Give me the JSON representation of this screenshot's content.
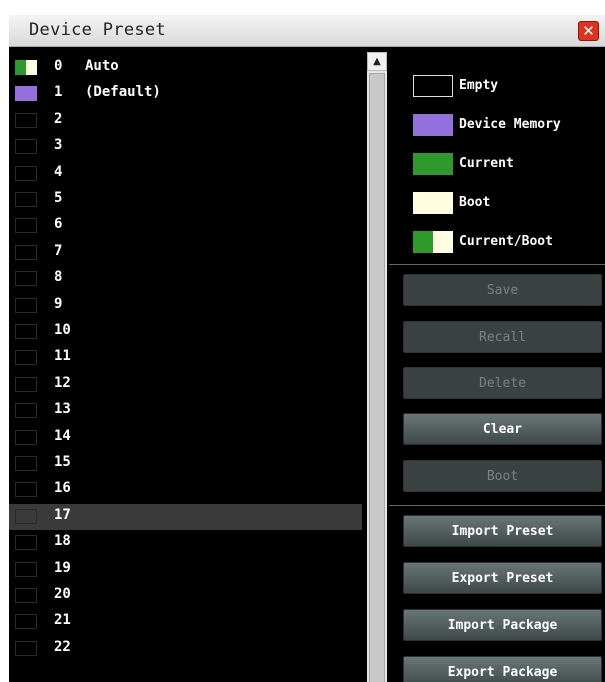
{
  "window": {
    "title": "Device Preset",
    "close_symbol": "✕"
  },
  "presets": [
    {
      "num": "0",
      "name": "Auto",
      "state": "current_boot"
    },
    {
      "num": "1",
      "name": "(Default)",
      "state": "device_memory"
    },
    {
      "num": "2",
      "name": "",
      "state": "empty"
    },
    {
      "num": "3",
      "name": "",
      "state": "empty"
    },
    {
      "num": "4",
      "name": "",
      "state": "empty"
    },
    {
      "num": "5",
      "name": "",
      "state": "empty"
    },
    {
      "num": "6",
      "name": "",
      "state": "empty"
    },
    {
      "num": "7",
      "name": "",
      "state": "empty"
    },
    {
      "num": "8",
      "name": "",
      "state": "empty"
    },
    {
      "num": "9",
      "name": "",
      "state": "empty"
    },
    {
      "num": "10",
      "name": "",
      "state": "empty"
    },
    {
      "num": "11",
      "name": "",
      "state": "empty"
    },
    {
      "num": "12",
      "name": "",
      "state": "empty"
    },
    {
      "num": "13",
      "name": "",
      "state": "empty"
    },
    {
      "num": "14",
      "name": "",
      "state": "empty"
    },
    {
      "num": "15",
      "name": "",
      "state": "empty"
    },
    {
      "num": "16",
      "name": "",
      "state": "empty"
    },
    {
      "num": "17",
      "name": "",
      "state": "empty",
      "selected": true
    },
    {
      "num": "18",
      "name": "",
      "state": "empty"
    },
    {
      "num": "19",
      "name": "",
      "state": "empty"
    },
    {
      "num": "20",
      "name": "",
      "state": "empty"
    },
    {
      "num": "21",
      "name": "",
      "state": "empty"
    },
    {
      "num": "22",
      "name": "",
      "state": "empty"
    }
  ],
  "legend": [
    {
      "label": "Empty",
      "kind": "empty"
    },
    {
      "label": "Device Memory",
      "kind": "device_memory"
    },
    {
      "label": "Current",
      "kind": "current"
    },
    {
      "label": "Boot",
      "kind": "boot"
    },
    {
      "label": "Current/Boot",
      "kind": "current_boot"
    }
  ],
  "actions": {
    "save": {
      "label": "Save",
      "enabled": false
    },
    "recall": {
      "label": "Recall",
      "enabled": false
    },
    "delete": {
      "label": "Delete",
      "enabled": false
    },
    "clear": {
      "label": "Clear",
      "enabled": true
    },
    "boot": {
      "label": "Boot",
      "enabled": false
    },
    "import_preset": {
      "label": "Import Preset",
      "enabled": true
    },
    "export_preset": {
      "label": "Export Preset",
      "enabled": true
    },
    "import_package": {
      "label": "Import Package",
      "enabled": true
    },
    "export_package": {
      "label": "Export Package",
      "enabled": true
    }
  },
  "colors": {
    "device_memory": "#9370db",
    "current": "#2e9a2e",
    "boot": "#fffde0",
    "background": "#000000",
    "selected_row": "#3a3a3a",
    "close_button": "#e0321e"
  }
}
